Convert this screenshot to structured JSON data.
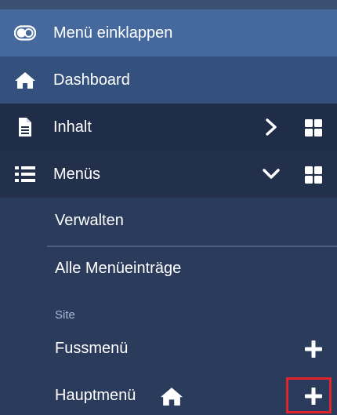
{
  "sidebar": {
    "collapse_label": "Menü einklappen",
    "items": [
      {
        "label": "Dashboard",
        "icon": "home-icon"
      },
      {
        "label": "Inhalt",
        "icon": "file-icon",
        "expanded": false
      },
      {
        "label": "Menüs",
        "icon": "list-icon",
        "expanded": true
      }
    ],
    "menus_sub": {
      "manage": "Verwalten",
      "all_items": "Alle Menüeinträge",
      "section_label": "Site",
      "menus": [
        {
          "label": "Fussmenü"
        },
        {
          "label": "Hauptmenü",
          "is_home": true
        }
      ]
    }
  },
  "colors": {
    "background": "#2a3b5c",
    "collapse_bg": "#45699c",
    "dashboard_bg": "#34507c",
    "highlight": "#e3242b"
  }
}
